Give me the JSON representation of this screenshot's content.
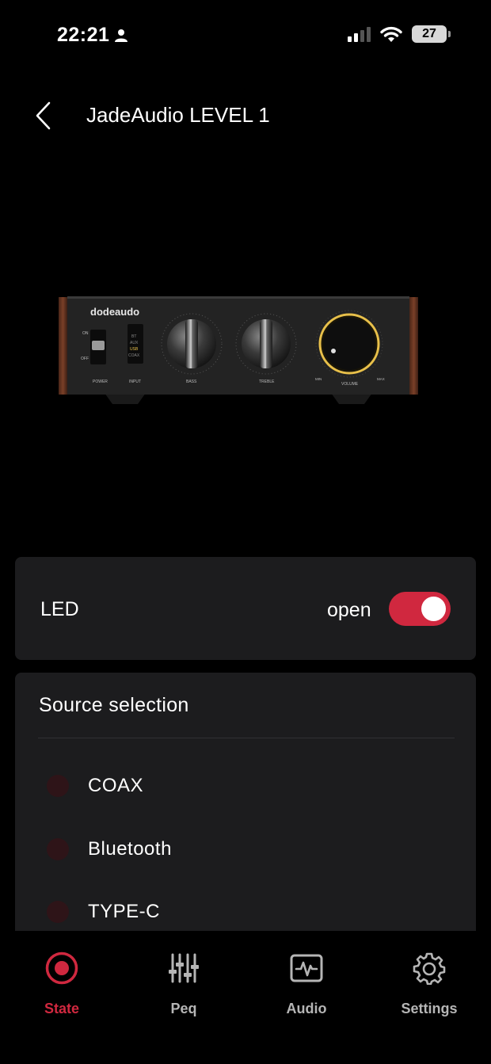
{
  "status_bar": {
    "time": "22:21",
    "battery": "27"
  },
  "header": {
    "title": "JadeAudio LEVEL 1"
  },
  "device": {
    "brand": "dodeaudo",
    "labels": {
      "power": "POWER",
      "input": "INPUT",
      "bass": "BASS",
      "treble": "TREBLE",
      "volume": "VOLUME",
      "on": "ON",
      "off": "OFF",
      "min": "MIN",
      "max": "MAX",
      "inputs": [
        "BT",
        "AUX",
        "USB",
        "COAX"
      ]
    }
  },
  "led": {
    "label": "LED",
    "status": "open",
    "enabled": true
  },
  "source": {
    "title": "Source selection",
    "options": [
      {
        "label": "COAX"
      },
      {
        "label": "Bluetooth"
      },
      {
        "label": "TYPE-C"
      }
    ]
  },
  "tabs": [
    {
      "label": "State",
      "icon": "record-icon",
      "active": true
    },
    {
      "label": "Peq",
      "icon": "sliders-icon",
      "active": false
    },
    {
      "label": "Audio",
      "icon": "waveform-icon",
      "active": false
    },
    {
      "label": "Settings",
      "icon": "gear-icon",
      "active": false
    }
  ],
  "colors": {
    "accent": "#d0283f",
    "card": "#1c1c1e",
    "volume_ring": "#e8c04a"
  }
}
